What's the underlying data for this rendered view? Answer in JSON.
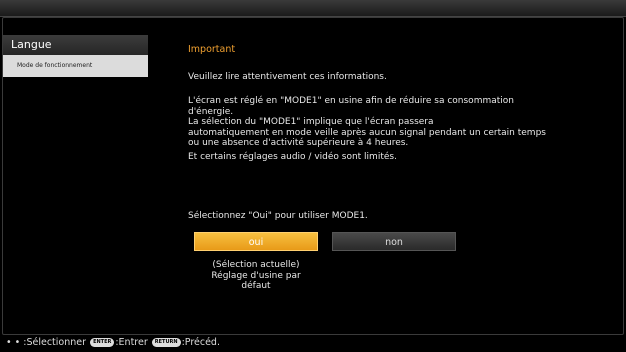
{
  "sidebar": {
    "items": [
      {
        "label": "Langue"
      },
      {
        "label": "Mode de fonctionnement"
      }
    ]
  },
  "dialog": {
    "heading": "Important",
    "intro": "Veuillez lire attentivement ces informations.",
    "body_lines": [
      "L'écran est réglé en \"MODE1\" en usine afin de réduire sa consommation",
      "d'énergie.",
      "La sélection du \"MODE1\" implique que l'écran passera",
      "automatiquement en mode veille après aucun signal pendant un certain temps",
      "ou une absence d'activité supérieure à 4 heures.",
      "Et certains réglages audio / vidéo sont limités."
    ],
    "prompt": "Sélectionnez \"Oui\" pour utiliser MODE1.",
    "buttons": {
      "oui": "oui",
      "non": "non"
    },
    "note_lines": [
      "(Sélection actuelle)",
      "Réglage d'usine par",
      "défaut"
    ]
  },
  "footer": {
    "arrows": "• •",
    "select": ":Sélectionner",
    "enter_key": "ENTER",
    "enter": ":Entrer",
    "return_key": "RETURN",
    "prev": ":Précéd."
  },
  "colors": {
    "accent": "#f0a030",
    "selected_button": "#f7b030",
    "background": "#000000"
  }
}
